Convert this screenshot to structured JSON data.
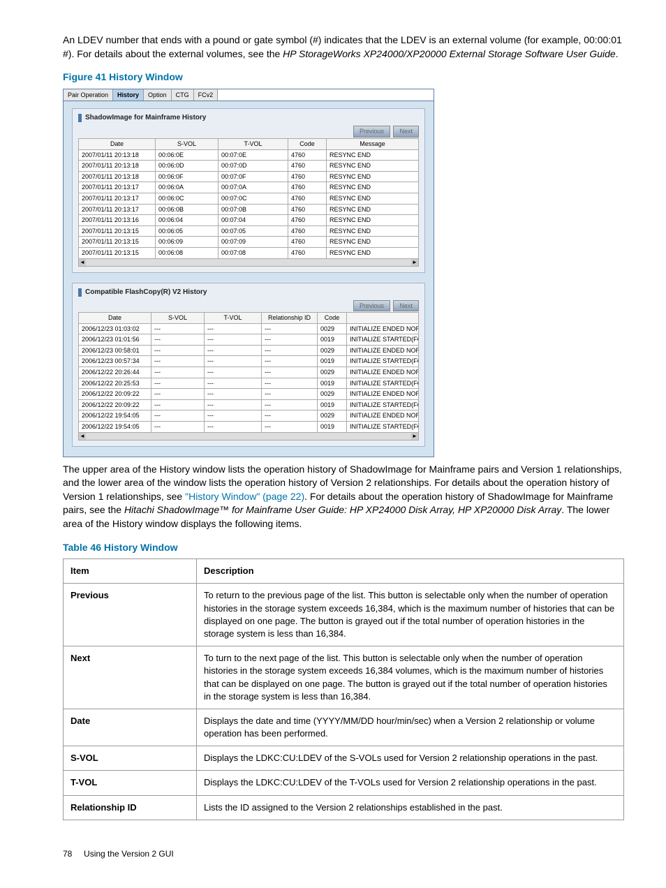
{
  "intro_text_pre": "An LDEV number that ends with a pound or gate symbol (#) indicates that the LDEV is an external volume (for example, 00:00:01 #). For details about the external volumes, see the ",
  "intro_text_italic": "HP StorageWorks XP24000/XP20000 External Storage Software User Guide",
  "intro_text_post": ".",
  "figure_title": "Figure 41 History Window",
  "tabs": [
    "Pair Operation",
    "History",
    "Option",
    "CTG",
    "FCv2"
  ],
  "tabs_active_index": 1,
  "panel1": {
    "title": "ShadowImage for Mainframe History",
    "btn_prev": "Previous",
    "btn_next": "Next",
    "headers": [
      "Date",
      "S-VOL",
      "T-VOL",
      "Code",
      "Message"
    ],
    "rows": [
      [
        "2007/01/11 20:13:18",
        "00:06:0E",
        "00:07:0E",
        "4760",
        "RESYNC END"
      ],
      [
        "2007/01/11 20:13:18",
        "00:06:0D",
        "00:07:0D",
        "4760",
        "RESYNC END"
      ],
      [
        "2007/01/11 20:13:18",
        "00:06:0F",
        "00:07:0F",
        "4760",
        "RESYNC END"
      ],
      [
        "2007/01/11 20:13:17",
        "00:06:0A",
        "00:07:0A",
        "4760",
        "RESYNC END"
      ],
      [
        "2007/01/11 20:13:17",
        "00:06:0C",
        "00:07:0C",
        "4760",
        "RESYNC END"
      ],
      [
        "2007/01/11 20:13:17",
        "00:06:0B",
        "00:07:0B",
        "4760",
        "RESYNC END"
      ],
      [
        "2007/01/11 20:13:16",
        "00:06:04",
        "00:07:04",
        "4760",
        "RESYNC END"
      ],
      [
        "2007/01/11 20:13:15",
        "00:06:05",
        "00:07:05",
        "4760",
        "RESYNC END"
      ],
      [
        "2007/01/11 20:13:15",
        "00:06:09",
        "00:07:09",
        "4760",
        "RESYNC END"
      ],
      [
        "2007/01/11 20:13:15",
        "00:06:08",
        "00:07:08",
        "4760",
        "RESYNC END"
      ]
    ]
  },
  "panel2": {
    "title": "Compatible FlashCopy(R) V2 History",
    "btn_prev": "Previous",
    "btn_next": "Next",
    "headers": [
      "Date",
      "S-VOL",
      "T-VOL",
      "Relationship ID",
      "Code",
      ""
    ],
    "rows": [
      [
        "2006/12/23 01:03:02",
        "---",
        "---",
        "---",
        "0029",
        "INITIALIZE ENDED NORI"
      ],
      [
        "2006/12/23 01:01:56",
        "---",
        "---",
        "---",
        "0019",
        "INITIALIZE STARTED(FC"
      ],
      [
        "2006/12/23 00:58:01",
        "---",
        "---",
        "---",
        "0029",
        "INITIALIZE ENDED NORI"
      ],
      [
        "2006/12/23 00:57:34",
        "---",
        "---",
        "---",
        "0019",
        "INITIALIZE STARTED(FC"
      ],
      [
        "2006/12/22 20:26:44",
        "---",
        "---",
        "---",
        "0029",
        "INITIALIZE ENDED NORI"
      ],
      [
        "2006/12/22 20:25:53",
        "---",
        "---",
        "---",
        "0019",
        "INITIALIZE STARTED(FC"
      ],
      [
        "2006/12/22 20:09:22",
        "---",
        "---",
        "---",
        "0029",
        "INITIALIZE ENDED NORI"
      ],
      [
        "2006/12/22 20:09:22",
        "---",
        "---",
        "---",
        "0019",
        "INITIALIZE STARTED(FC"
      ],
      [
        "2006/12/22 19:54:05",
        "---",
        "---",
        "---",
        "0029",
        "INITIALIZE ENDED NORI"
      ],
      [
        "2006/12/22 19:54:05",
        "---",
        "---",
        "---",
        "0019",
        "INITIALIZE STARTED(FC"
      ]
    ]
  },
  "mid_text_1": "The upper area of the History window lists the operation history of ShadowImage for Mainframe pairs and Version 1 relationships, and the lower area of the window lists the operation history of Version 2 relationships. For details about the operation history of Version 1 relationships, see ",
  "mid_link": "\"History Window\" (page 22)",
  "mid_text_2": ". For details about the operation history of ShadowImage for Mainframe pairs, see the ",
  "mid_italic": "Hitachi ShadowImage™ for Mainframe User Guide: HP XP24000 Disk Array, HP XP20000 Disk Array",
  "mid_text_3": ". The lower area of the History window displays the following items.",
  "table_title": "Table 46 History Window",
  "doc_table": {
    "headers": [
      "Item",
      "Description"
    ],
    "rows": [
      [
        "Previous",
        "To return to the previous page of the list. This button is selectable only when the number of operation histories in the storage system exceeds 16,384, which is the maximum number of histories that can be displayed on one page. The button is grayed out if the total number of operation histories in the storage system is less than 16,384."
      ],
      [
        "Next",
        "To turn to the next page of the list. This button is selectable only when the number of operation histories in the storage system exceeds 16,384 volumes, which is the maximum number of histories that can be displayed on one page. The button is grayed out if the total number of operation histories in the storage system is less than 16,384."
      ],
      [
        "Date",
        "Displays the date and time (YYYY/MM/DD hour/min/sec) when a Version 2 relationship or volume operation has been performed."
      ],
      [
        "S-VOL",
        "Displays the LDKC:CU:LDEV of the S-VOLs used for Version 2 relationship operations in the past."
      ],
      [
        "T-VOL",
        "Displays the LDKC:CU:LDEV of the T-VOLs used for Version 2 relationship operations in the past."
      ],
      [
        "Relationship ID",
        "Lists the ID assigned to the Version 2 relationships established in the past."
      ]
    ]
  },
  "footer_page": "78",
  "footer_text": "Using the Version 2 GUI"
}
